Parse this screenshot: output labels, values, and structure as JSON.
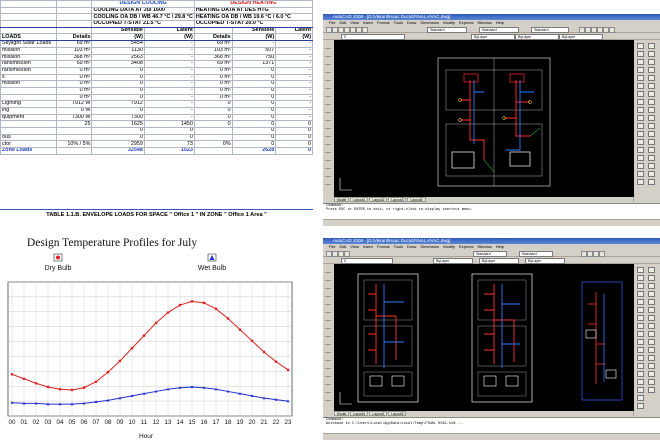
{
  "load_table": {
    "cooling_header": "DESIGN COOLING",
    "heating_header": "DESIGN HEATING",
    "cooling_info": [
      "COOLING DATA AT Jul 1600",
      "COOLING OA DB / WB    46.7 °C / 29.8 °C",
      "OCCUPIED T-STAT 21.5 °C"
    ],
    "heating_info": [
      "HEATING DATA AT DES HTG",
      "HEATING OA DB / WB    19.6 °C / 6.0 °C",
      "OCCUPIED T-STAT 20.0 °C"
    ],
    "col_loads": "LOADS",
    "col_details": "Details",
    "col_sensible": "Sensible",
    "col_latent": "Latent",
    "unit_w": "(W)",
    "rows": [
      [
        "Skylight Solar Loads",
        "69 m²",
        "5454",
        "-",
        "69 m²",
        "-",
        "-"
      ],
      [
        "mission",
        "103 m²",
        "1130",
        "-",
        "103 m²",
        "507",
        "-"
      ],
      [
        "mission",
        "368 m²",
        "2563",
        "-",
        "368 m²",
        "750",
        "-"
      ],
      [
        "ransmission",
        "69 m²",
        "3408",
        "-",
        "69 m²",
        "1371",
        "-"
      ],
      [
        "ransmission",
        "0 m²",
        "0",
        "-",
        "0 m²",
        "0",
        "-"
      ],
      [
        "s",
        "0 m²",
        "0",
        "-",
        "0 m²",
        "0",
        "-"
      ],
      [
        "mission",
        "0 m²",
        "0",
        "-",
        "0 m²",
        "0",
        "-"
      ],
      [
        "",
        "0 m²",
        "0",
        "-",
        "0 m²",
        "0",
        "-"
      ],
      [
        "",
        "0 m²",
        "0",
        "-",
        "0 m²",
        "0",
        "-"
      ],
      [
        "Lighting",
        "7912 W",
        "7912",
        "-",
        "0",
        "0",
        "-"
      ],
      [
        "ing",
        "0 W",
        "0",
        "-",
        "0",
        "0",
        "-"
      ],
      [
        "quipment",
        "7300 W",
        "7300",
        "-",
        "0",
        "0",
        "-"
      ],
      [
        "",
        "25",
        "1625",
        "1450",
        "0",
        "0",
        "0"
      ],
      [
        "",
        "",
        "0",
        "0",
        "",
        "0",
        "0"
      ],
      [
        "ous",
        "",
        "0",
        "0",
        "",
        "0",
        "0"
      ],
      [
        "ctor",
        "10% / 5%",
        "2959",
        "73",
        "0%",
        "0",
        "0"
      ]
    ],
    "total_row": [
      "Zone Loads",
      "",
      "32548",
      "1523",
      "",
      "2628",
      "0"
    ],
    "caption": "TABLE 1.1.B.    ENVELOPE LOADS FOR SPACE   \" Office 1 \"   IN ZONE   \" Office 1 Area \""
  },
  "chart_data": {
    "type": "line",
    "title": "Design Temperature Profiles for July",
    "xlabel": "Hour",
    "ylabel": "",
    "x": [
      "00",
      "01",
      "02",
      "03",
      "04",
      "05",
      "06",
      "07",
      "08",
      "09",
      "10",
      "11",
      "12",
      "13",
      "14",
      "15",
      "16",
      "17",
      "18",
      "19",
      "20",
      "21",
      "22",
      "23"
    ],
    "series": [
      {
        "name": "Dry Bulb",
        "color": "#e02020",
        "marker": "circle",
        "values": [
          35.6,
          35.0,
          34.4,
          33.9,
          33.6,
          33.5,
          33.8,
          34.6,
          35.9,
          37.4,
          39.1,
          40.8,
          42.5,
          43.9,
          44.9,
          45.4,
          45.2,
          44.4,
          43.1,
          41.6,
          40.1,
          38.6,
          37.3,
          36.2
        ]
      },
      {
        "name": "Wet Bulb",
        "color": "#2030d0",
        "marker": "triangle",
        "values": [
          31.8,
          31.7,
          31.7,
          31.6,
          31.6,
          31.6,
          31.7,
          31.9,
          32.1,
          32.4,
          32.7,
          33.0,
          33.3,
          33.6,
          33.8,
          33.9,
          33.8,
          33.6,
          33.3,
          33.0,
          32.7,
          32.4,
          32.2,
          32.0
        ]
      }
    ],
    "ylim": [
      30,
      48
    ],
    "grid": true,
    "legend": "top"
  },
  "cad_top": {
    "title": "AutoCAD 2008 - [D:\\Vikrant\\Hvac Ducts\\FINAL HVAC.dwg]",
    "menu": [
      "File",
      "Edit",
      "View",
      "Insert",
      "Format",
      "Tools",
      "Draw",
      "Dimension",
      "Modify",
      "Express",
      "Window",
      "Help"
    ],
    "style_combo": "Standard",
    "text_combo": "Standard",
    "dim_combo": "Standard",
    "layer_combo": "0",
    "bylayer1": "ByLayer",
    "bylayer2": "ByLayer",
    "bylayer3": "ByLayer",
    "tabs": [
      "Model",
      "Layout1",
      "Layout2",
      "Layout3",
      "Layout4"
    ],
    "cmd_lines": [
      "Command:",
      "Press ESC or ENTER to exit, or right-click to display shortcut menu."
    ]
  },
  "cad_bottom": {
    "title": "AutoCAD 2008 - [D:\\Vikrant\\Hvac Ducts\\FINAL HVAC.dwg]",
    "menu": [
      "File",
      "Edit",
      "View",
      "Insert",
      "Format",
      "Tools",
      "Draw",
      "Dimension",
      "Modify",
      "Express",
      "Window",
      "Help"
    ],
    "style_combo": "Standard",
    "text_combo": "Standard",
    "layer_combo": "0",
    "bylayer1": "ByLayer",
    "bylayer2": "ByLayer",
    "bylayer3": "ByLayer",
    "tabs": [
      "Model",
      "Layout1",
      "Layout2",
      "Layout3"
    ],
    "cmd_lines": [
      "Command:",
      "Autosave to C:\\Users\\Local\\AppData\\Local\\Temp\\FINAL HVAC.sv$ ..."
    ]
  }
}
